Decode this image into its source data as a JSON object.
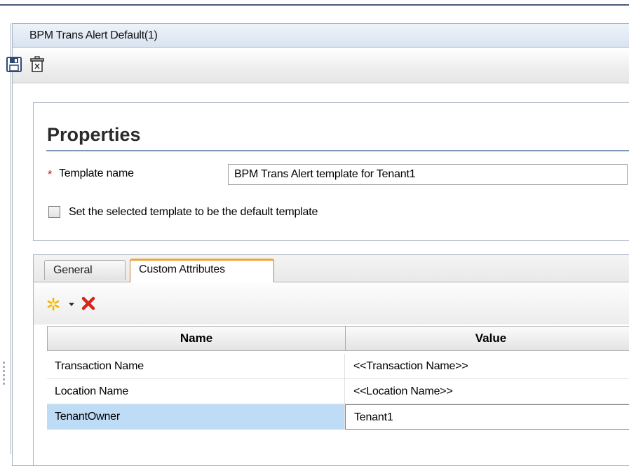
{
  "panel": {
    "title": "BPM Trans Alert Default(1)"
  },
  "toolbar": {
    "icons": [
      "save-icon",
      "delete-icon"
    ]
  },
  "properties": {
    "heading": "Properties",
    "template_name_label": "Template name",
    "required_marker": "*",
    "template_name_value": "BPM Trans Alert template for Tenant1",
    "default_checkbox_label": "Set the selected template to be the default template",
    "default_checked": false
  },
  "tabs": [
    {
      "label": "General",
      "active": false
    },
    {
      "label": "Custom Attributes",
      "active": true
    }
  ],
  "attributes_toolbar": {
    "icons": [
      "new-icon",
      "dropdown-arrow-icon",
      "delete-red-x-icon"
    ]
  },
  "grid": {
    "columns": [
      "Name",
      "Value"
    ],
    "rows": [
      {
        "name": "Transaction Name",
        "value": "<<Transaction Name>>",
        "selected": false
      },
      {
        "name": "Location Name",
        "value": "<<Location Name>>",
        "selected": false
      },
      {
        "name": "TenantOwner",
        "value": "Tenant1",
        "selected": true
      }
    ]
  },
  "colors": {
    "accent_tab": "#f0a33a",
    "selection": "#bfdcf7",
    "required": "#d0021b",
    "delete_red": "#d8261a",
    "new_star": "#f4b400"
  }
}
